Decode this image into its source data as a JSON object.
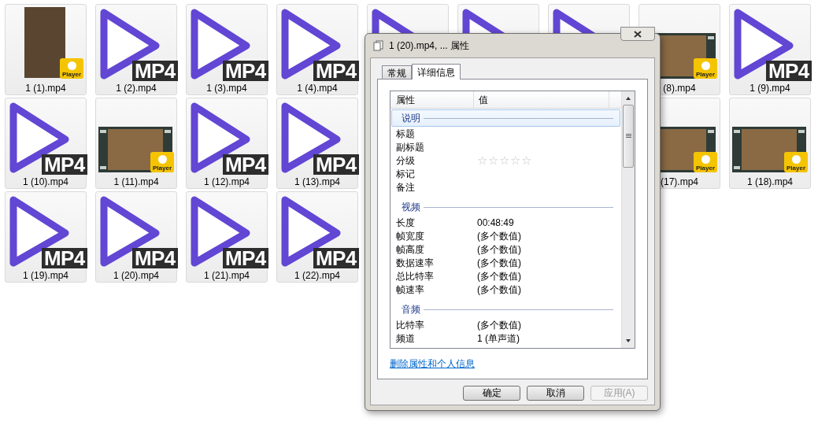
{
  "file_grid": {
    "rows": [
      {
        "left": [
          {
            "kind": "portrait_video",
            "badge": "Player",
            "label": "1 (1).mp4"
          },
          {
            "kind": "mp4",
            "badge": "MP4",
            "label": "1 (2).mp4"
          },
          {
            "kind": "mp4",
            "badge": "MP4",
            "label": "1 (3).mp4"
          },
          {
            "kind": "mp4",
            "badge": "MP4",
            "label": "1 (4).mp4"
          },
          {
            "kind": "mp4"
          },
          {
            "kind": "mp4"
          },
          {
            "kind": "mp4"
          }
        ],
        "right": [
          {
            "kind": "video",
            "badge": "Player",
            "label": "(8).mp4"
          },
          {
            "kind": "mp4",
            "badge": "MP4",
            "label": "1 (9).mp4"
          }
        ]
      },
      {
        "left": [
          {
            "kind": "mp4",
            "badge": "MP4",
            "label": "1 (10).mp4"
          },
          {
            "kind": "video",
            "badge": "Player",
            "label": "1 (11).mp4"
          },
          {
            "kind": "mp4",
            "badge": "MP4",
            "label": "1 (12).mp4"
          },
          {
            "kind": "mp4",
            "badge": "MP4",
            "label": "1 (13).mp4"
          }
        ],
        "right": [
          {
            "kind": "video",
            "badge": "Player",
            "label": "(17).mp4"
          },
          {
            "kind": "video",
            "badge": "Player",
            "label": "1 (18).mp4"
          }
        ]
      },
      {
        "left": [
          {
            "kind": "mp4",
            "badge": "MP4",
            "label": "1 (19).mp4"
          },
          {
            "kind": "mp4",
            "badge": "MP4",
            "label": "1 (20).mp4"
          },
          {
            "kind": "mp4",
            "badge": "MP4",
            "label": "1 (21).mp4"
          },
          {
            "kind": "mp4",
            "badge": "MP4",
            "label": "1 (22).mp4"
          }
        ],
        "right": []
      }
    ]
  },
  "dialog": {
    "title": "1 (20).mp4, ... 属性",
    "tabs": [
      {
        "label": "常规",
        "selected": false
      },
      {
        "label": "详细信息",
        "selected": true
      }
    ],
    "columns": [
      "属性",
      "值"
    ],
    "groups": [
      {
        "name": "说明",
        "selected": true,
        "rows": [
          {
            "kind": "text",
            "property": "标题"
          },
          {
            "kind": "text",
            "property": "副标题"
          },
          {
            "kind": "rating",
            "property": "分级",
            "stars": 0
          },
          {
            "kind": "text",
            "property": "标记"
          },
          {
            "kind": "text",
            "property": "备注"
          }
        ]
      },
      {
        "name": "视频",
        "selected": false,
        "rows": [
          {
            "kind": "text",
            "property": "长度",
            "value": "00:48:49"
          },
          {
            "kind": "text",
            "property": "帧宽度",
            "value": "(多个数值)"
          },
          {
            "kind": "text",
            "property": "帧高度",
            "value": "(多个数值)"
          },
          {
            "kind": "text",
            "property": "数据速率",
            "value": "(多个数值)"
          },
          {
            "kind": "text",
            "property": "总比特率",
            "value": "(多个数值)"
          },
          {
            "kind": "text",
            "property": "帧速率",
            "value": "(多个数值)"
          }
        ]
      },
      {
        "name": "音频",
        "selected": false,
        "rows": [
          {
            "kind": "text",
            "property": "比特率",
            "value": "(多个数值)"
          },
          {
            "kind": "text",
            "property": "频道",
            "value": "1 (单声道)"
          }
        ]
      }
    ],
    "link": "删除属性和个人信息",
    "buttons": [
      {
        "label": "确定",
        "disabled": false
      },
      {
        "label": "取消",
        "disabled": false
      },
      {
        "label": "应用(A)",
        "disabled": true
      }
    ]
  }
}
